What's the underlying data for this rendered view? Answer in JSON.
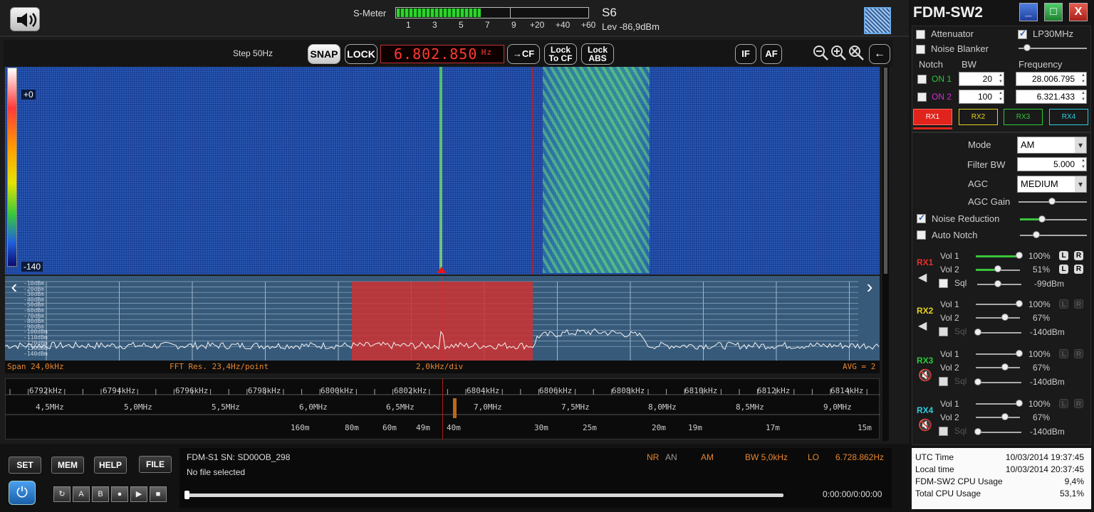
{
  "smeter": {
    "label": "S-Meter",
    "scale": [
      "1",
      "3",
      "5",
      "7",
      "9",
      "+20",
      "+40",
      "+60"
    ],
    "level_fraction": 0.44,
    "s_value": "S6",
    "level_text": "Lev -86,9dBm"
  },
  "toolbar": {
    "step": "Step 50Hz",
    "snap": "SNAP",
    "lock": "LOCK",
    "frequency": "6.802.850",
    "freq_unit": "Hz",
    "to_cf": "→CF",
    "lock_to_cf": "Lock\nTo CF",
    "lock_abs": "Lock\nABS",
    "if": "IF",
    "af": "AF"
  },
  "waterfall": {
    "top_label": "+0",
    "bottom_label": "-140"
  },
  "spectrum": {
    "db_labels": [
      "-10dBm",
      "-20dBm",
      "-30dBm",
      "-40dBm",
      "-50dBm",
      "-60dBm",
      "-70dBm",
      "-80dBm",
      "-90dBm",
      "-100dBm",
      "-110dBm",
      "-120dBm",
      "-130dBm",
      "-140dBm"
    ],
    "span": "Span 24,0kHz",
    "fft_res": "FFT Res. 23,4Hz/point",
    "div": "2,0kHz/div",
    "avg": "AVG = 2"
  },
  "scale": {
    "khz": [
      "6792kHz",
      "6794kHz",
      "6796kHz",
      "6798kHz",
      "6800kHz",
      "6802kHz",
      "6804kHz",
      "6806kHz",
      "6808kHz",
      "6810kHz",
      "6812kHz",
      "6814kHz"
    ],
    "mhz": [
      "4,5MHz",
      "5,0MHz",
      "5,5MHz",
      "6,0MHz",
      "6,5MHz",
      "7,0MHz",
      "7,5MHz",
      "8,0MHz",
      "8,5MHz",
      "9,0MHz"
    ],
    "bands": [
      "160m",
      "80m",
      "60m",
      "49m",
      "40m",
      "30m",
      "25m",
      "20m",
      "19m",
      "17m",
      "15m"
    ]
  },
  "bottom": {
    "set": "SET",
    "mem": "MEM",
    "help": "HELP",
    "file": "FILE",
    "transport": [
      "A",
      "B"
    ],
    "device": "FDM-S1 SN: SD00OB_298",
    "file_status": "No file selected",
    "nr": "NR",
    "an": "AN",
    "mode": "AM",
    "bw": "BW 5,0kHz",
    "lo_label": "LO",
    "lo_value": "6.728.862Hz",
    "time": "0:00:00/0:00:00",
    "progress_fraction": 0.0
  },
  "panel": {
    "title": "FDM-SW2",
    "window_buttons": [
      "_",
      "□",
      "X"
    ],
    "attenuator": "Attenuator",
    "lp30": "LP30MHz",
    "noise_blanker": "Noise Blanker",
    "notch_header": "Notch",
    "bw_header": "BW",
    "freq_header": "Frequency",
    "on1": "ON 1",
    "on2": "ON 2",
    "notch1_bw": "20",
    "notch2_bw": "100",
    "notch1_freq": "28.006.795",
    "notch2_freq": "6.321.433",
    "rx_tabs": [
      "RX1",
      "RX2",
      "RX3",
      "RX4"
    ],
    "mode_label": "Mode",
    "mode_value": "AM",
    "filter_label": "Filter BW",
    "filter_value": "5.000",
    "agc_label": "AGC",
    "agc_value": "MEDIUM",
    "agc_gain": "AGC Gain",
    "noise_reduction": "Noise Reduction",
    "auto_notch": "Auto Notch",
    "rx": [
      {
        "name": "RX1",
        "color": "#e8302a",
        "vol1": "Vol 1",
        "vol1_pct": "100%",
        "vol2": "Vol 2",
        "vol2_pct": "51%",
        "sql": "Sql",
        "sql_val": "-99dBm"
      },
      {
        "name": "RX2",
        "color": "#e6d21e",
        "vol1": "Vol 1",
        "vol1_pct": "100%",
        "vol2": "Vol 2",
        "vol2_pct": "67%",
        "sql": "Sql",
        "sql_val": "-140dBm"
      },
      {
        "name": "RX3",
        "color": "#2ec83a",
        "vol1": "Vol 1",
        "vol1_pct": "100%",
        "vol2": "Vol 2",
        "vol2_pct": "67%",
        "sql": "Sql",
        "sql_val": "-140dBm"
      },
      {
        "name": "RX4",
        "color": "#2ccde0",
        "vol1": "Vol 1",
        "vol1_pct": "100%",
        "vol2": "Vol 2",
        "vol2_pct": "67%",
        "sql": "Sql",
        "sql_val": "-140dBm"
      }
    ],
    "lr": [
      "L",
      "R"
    ]
  },
  "status": {
    "utc_label": "UTC Time",
    "utc_value": "10/03/2014 19:37:45",
    "local_label": "Local time",
    "local_value": "10/03/2014 20:37:45",
    "cpu_label": "FDM-SW2 CPU Usage",
    "cpu_value": "9,4%",
    "total_label": "Total CPU Usage",
    "total_value": "53,1%"
  },
  "colors": {
    "accent_red": "#ff3b30",
    "orange": "#e8852e",
    "waterfall_blue": "#1d4aa8"
  }
}
